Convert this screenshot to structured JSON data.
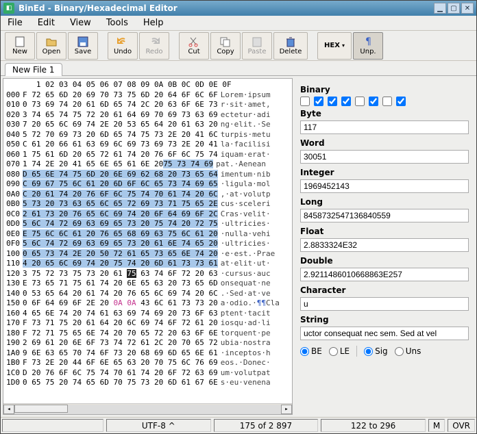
{
  "window": {
    "title": "BinEd - Binary/Hexadecimal Editor"
  },
  "menu": {
    "file": "File",
    "edit": "Edit",
    "view": "View",
    "tools": "Tools",
    "help": "Help"
  },
  "toolbar": {
    "new": "New",
    "open": "Open",
    "save": "Save",
    "undo": "Undo",
    "redo": "Redo",
    "cut": "Cut",
    "copy": "Copy",
    "paste": "Paste",
    "delete": "Delete",
    "hex": "HEX",
    "unp": "Unp."
  },
  "tabs": {
    "file1": "New File 1"
  },
  "hex": {
    "cols_header": "   1 02 03 04 05 06 07 08 09 0A 0B 0C 0D 0E 0F",
    "rows": [
      {
        "off": "000",
        "hex": "F 72 65 6D 20 69 70 73 75 6D 20 64 6F 6C 6F",
        "asc": "Lorem·ipsum"
      },
      {
        "off": "010",
        "hex": "0 73 69 74 20 61 6D 65 74 2C 20 63 6F 6E 73",
        "asc": "r·sit·amet,"
      },
      {
        "off": "020",
        "hex": "3 74 65 74 75 72 20 61 64 69 70 69 73 63 69",
        "asc": "ectetur·adi"
      },
      {
        "off": "030",
        "hex": "7 20 65 6C 69 74 2E 20 53 65 64 20 61 63 20",
        "asc": "ng·elit.·Se"
      },
      {
        "off": "040",
        "hex": "5 72 70 69 73 20 6D 65 74 75 73 2E 20 41 6C",
        "asc": "turpis·metu"
      },
      {
        "off": "050",
        "hex": "C 61 20 66 61 63 69 6C 69 73 69 73 2E 20 41",
        "asc": "la·facilisi"
      },
      {
        "off": "060",
        "hex": "1 75 61 6D 20 65 72 61 74 20 76 6F 6C 75 74",
        "asc": "iquam·erat·"
      },
      {
        "off": "070",
        "hex": "1 74 2E 20 41 65 6E 65 61 6E 20",
        "asc": "pat.·Aenean",
        "sel_hex": "75 73 74 69",
        "sel_start": 11
      },
      {
        "off": "080",
        "hex_sel": "D 65 6E 74 75 6D 20 6E 69 62 68 20 73 65 64",
        "asc": "imentum·nib"
      },
      {
        "off": "090",
        "hex_sel": "C 69 67 75 6C 61 20 6D 6F 6C 65 73 74 69 65",
        "asc": "·ligula·mol"
      },
      {
        "off": "0A0",
        "hex_sel": "C 20 61 74 20 76 6F 6C 75 74 70 61 74 20 6C",
        "asc": ",·at·volutp"
      },
      {
        "off": "0B0",
        "hex_sel": "5 73 20 73 63 65 6C 65 72 69 73 71 75 65 2E",
        "asc": "cus·sceleri"
      },
      {
        "off": "0C0",
        "hex_sel": "2 61 73 20 76 65 6C 69 74 20 6F 64 69 6F 2C",
        "asc": "Cras·velit·"
      },
      {
        "off": "0D0",
        "hex_sel": "5 6C 74 72 69 63 69 65 73 20 75 74 20 72 75",
        "asc": "·ultricies·"
      },
      {
        "off": "0E0",
        "hex_sel": "E 75 6C 6C 61 20 76 65 68 69 63 75 6C 61 20",
        "asc": "·nulla·vehi"
      },
      {
        "off": "0F0",
        "hex_sel": "5 6C 74 72 69 63 69 65 73 20 61 6E 74 65 20",
        "asc": "·ultricies·"
      },
      {
        "off": "100",
        "hex_sel": "0 65 73 74 2E 20 50 72 61 65 73 65 6E 74 20",
        "asc": "·e·est.·Prae"
      },
      {
        "off": "110",
        "hex_sel": "4 20 65 6C 69 74 20 75 74 20 6D 61 73 73 61",
        "asc": "at·elit·ut·"
      },
      {
        "off": "120",
        "hex": "3 75 72 73 75 73 20 61",
        "cursor": "75",
        "post": " 63 74 6F 72 20 63",
        "asc": "·cursus·auc"
      },
      {
        "off": "130",
        "hex": "E 73 65 71 75 61 74 20 6E 65 63 20 73 65 6D",
        "asc": "onsequat·ne"
      },
      {
        "off": "140",
        "hex": "0 53 65 64 20 61 74 20 76 65 6C 69 74 20 6C",
        "asc": ".·Sed·at·ve"
      },
      {
        "off": "150",
        "hex": "0 6F 64 69 6F 2E 20 ",
        "pink": "0A 0A",
        "post2": " 43 6C 61 73 73 20",
        "asc": "a·odio.·",
        "qq": "¶¶",
        "asc2": "Cla"
      },
      {
        "off": "160",
        "hex": "4 65 6E 74 20 74 61 63 69 74 69 20 73 6F 63",
        "asc": "ptent·tacit"
      },
      {
        "off": "170",
        "hex": "F 73 71 75 20 61 64 20 6C 69 74 6F 72 61 20",
        "asc": "iosqu·ad·li"
      },
      {
        "off": "180",
        "hex": "F 72 71 75 65 6E 74 20 70 65 72 20 63 6F 6E",
        "asc": "torquent·pe"
      },
      {
        "off": "190",
        "hex": "2 69 61 20 6E 6F 73 74 72 61 2C 20 70 65 72",
        "asc": "ubia·nostra"
      },
      {
        "off": "1A0",
        "hex": "9 6E 63 65 70 74 6F 73 20 68 69 6D 65 6E 61",
        "asc": "·inceptos·h"
      },
      {
        "off": "1B0",
        "hex": "F 73 2E 20 44 6F 6E 65 63 20 70 75 6C 76 69",
        "asc": "eos.·Donec·"
      },
      {
        "off": "1C0",
        "hex": "D 20 76 6F 6C 75 74 70 61 74 20 6F 72 63 69",
        "asc": "um·volutpat"
      },
      {
        "off": "1D0",
        "hex": "0 65 75 20 74 65 6D 70 75 73 20 6D 61 67 6E",
        "asc": "s·eu·venena"
      }
    ]
  },
  "values": {
    "binary_label": "Binary",
    "bits": [
      false,
      true,
      true,
      true,
      false,
      true,
      false,
      true
    ],
    "byte_label": "Byte",
    "byte": "117",
    "word_label": "Word",
    "word": "30051",
    "integer_label": "Integer",
    "integer": "1969452143",
    "long_label": "Long",
    "long": "8458732547136840559",
    "float_label": "Float",
    "float": "2.8833324E32",
    "double_label": "Double",
    "double": "2.9211486010668863E257",
    "character_label": "Character",
    "character": "u",
    "string_label": "String",
    "string": "uctor consequat nec sem. Sed at vel",
    "be": "BE",
    "le": "LE",
    "sig": "Sig",
    "uns": "Uns"
  },
  "status": {
    "encoding": "UTF-8 ^",
    "position": "175 of 2 897",
    "selection": "122 to 296",
    "m": "M",
    "ovr": "OVR"
  }
}
